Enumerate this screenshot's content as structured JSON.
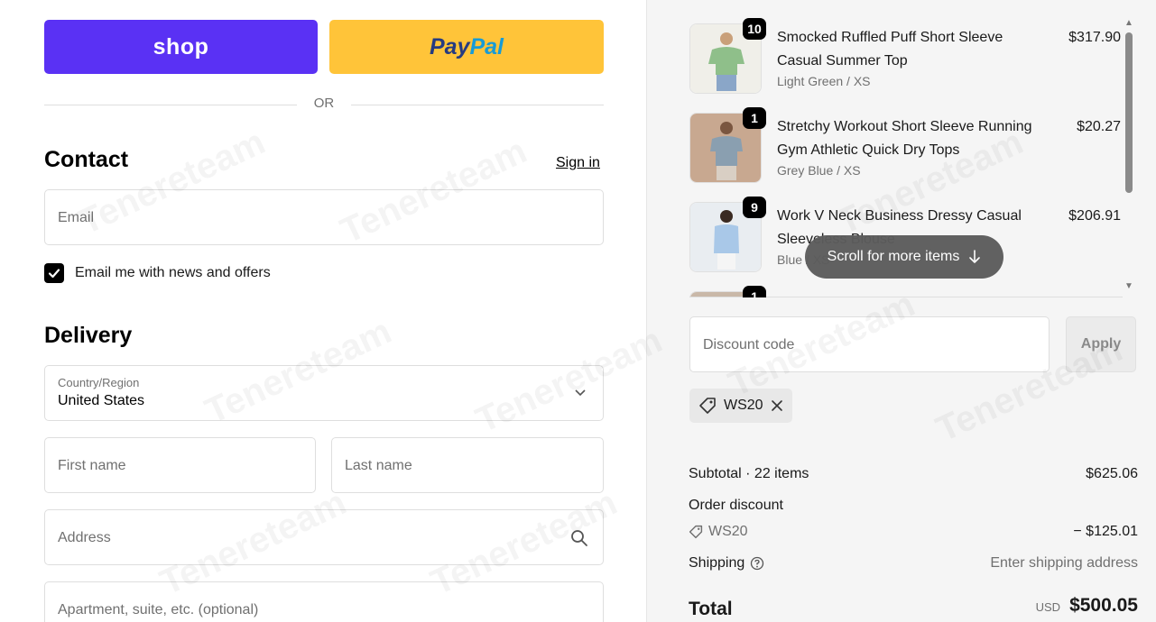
{
  "express": {
    "shop_label": "shop",
    "paypal_a": "Pay",
    "paypal_b": "Pal",
    "or_label": "OR"
  },
  "contact": {
    "title": "Contact",
    "signin_label": "Sign in",
    "email_placeholder": "Email",
    "newsletter_label": "Email me with news and offers",
    "newsletter_checked": true
  },
  "delivery": {
    "title": "Delivery",
    "country_label": "Country/Region",
    "country_value": "United States",
    "first_name_placeholder": "First name",
    "last_name_placeholder": "Last name",
    "address_placeholder": "Address",
    "apartment_placeholder": "Apartment, suite, etc. (optional)"
  },
  "cart": {
    "items": [
      {
        "qty": "10",
        "title": "Smocked Ruffled Puff Short Sleeve Casual Summer Top",
        "variant": "Light Green / XS",
        "price": "$317.90",
        "color": "#8fbf8a"
      },
      {
        "qty": "1",
        "title": "Stretchy Workout Short Sleeve Running Gym Athletic Quick Dry Tops",
        "variant": "Grey Blue / XS",
        "price": "$20.27",
        "color": "#8a9fb0"
      },
      {
        "qty": "9",
        "title": "Work V Neck Business Dressy Casual Sleeveless Blouse",
        "variant": "Blue / XS",
        "price": "$206.91",
        "color": "#a9c8e8"
      },
      {
        "qty": "1",
        "title": "",
        "variant": "",
        "price": "",
        "color": "#c9b8a8"
      }
    ],
    "scroll_hint": "Scroll for more items"
  },
  "discount": {
    "placeholder": "Discount code",
    "apply_label": "Apply",
    "applied_code": "WS20"
  },
  "summary": {
    "subtotal_label": "Subtotal · 22 items",
    "subtotal_value": "$625.06",
    "order_discount_label": "Order discount",
    "discount_code": "WS20",
    "discount_value": "− $125.01",
    "shipping_label": "Shipping",
    "shipping_value": "Enter shipping address",
    "total_label": "Total",
    "currency": "USD",
    "total_value": "$500.05"
  },
  "watermark": "Tenereteam"
}
